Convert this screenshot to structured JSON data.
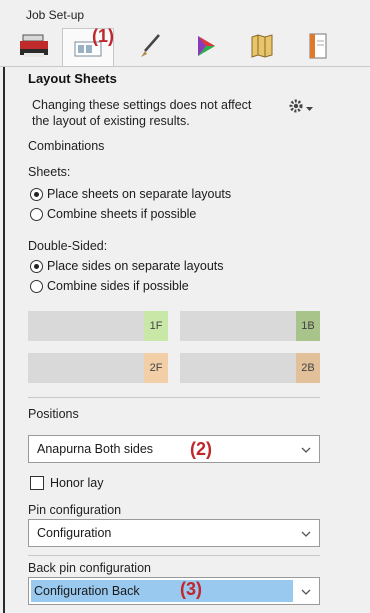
{
  "window": {
    "title": "Job Set-up"
  },
  "toolbar": {
    "tools": [
      {
        "icon": "printer-icon"
      },
      {
        "icon": "layout-sheet-icon"
      },
      {
        "icon": "brush-icon"
      },
      {
        "icon": "color-wheel-icon"
      },
      {
        "icon": "folded-map-icon"
      },
      {
        "icon": "document-icon"
      }
    ],
    "active_tool": 1
  },
  "callouts": {
    "one": "(1)",
    "two": "(2)",
    "three": "(3)"
  },
  "panel": {
    "heading": "Layout Sheets",
    "description": "Changing these settings does not affect the layout of existing results.",
    "gear_icon": "gear-icon",
    "combinations_label": "Combinations",
    "sheets": {
      "label": "Sheets:",
      "options": [
        "Place sheets on separate layouts",
        "Combine sheets if possible"
      ],
      "selected": 0
    },
    "double_sided": {
      "label": "Double-Sided:",
      "options": [
        "Place sides on separate layouts",
        "Combine sides if possible"
      ],
      "selected": 0
    },
    "tiles": [
      {
        "tag": "1F",
        "tag_color": "#c9e8a8"
      },
      {
        "tag": "1B",
        "tag_color": "#a9c48a"
      },
      {
        "tag": "2F",
        "tag_color": "#f2cfa6"
      },
      {
        "tag": "2B",
        "tag_color": "#e2c09a"
      }
    ],
    "positions": {
      "label": "Positions",
      "value": "Anapurna Both sides"
    },
    "honor_lay": {
      "label": "Honor lay",
      "checked": false
    },
    "pin_configuration": {
      "label": "Pin configuration",
      "value": "Configuration"
    },
    "back_pin_configuration": {
      "label": "Back pin configuration",
      "value": "Configuration Back"
    }
  }
}
